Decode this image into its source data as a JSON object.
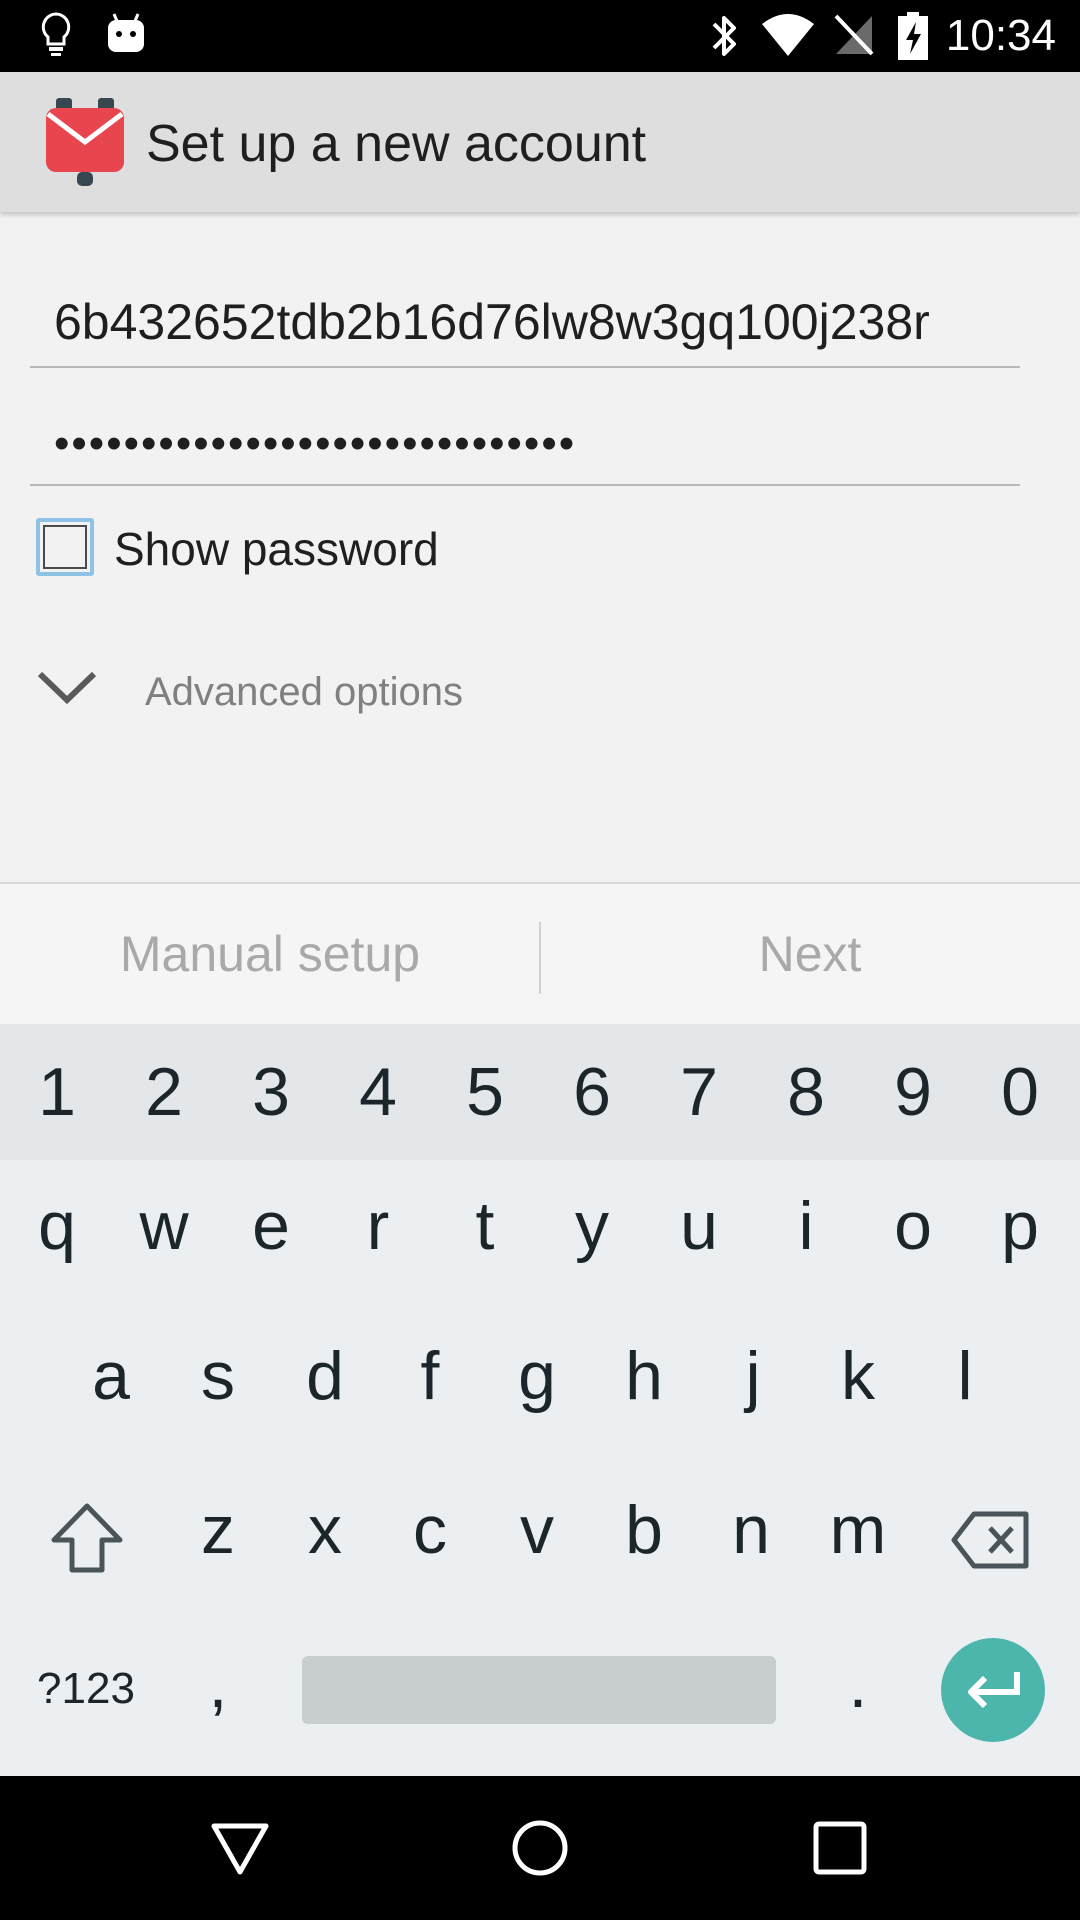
{
  "status_bar": {
    "time": "10:34",
    "icons": [
      "lightbulb-icon",
      "android-icon",
      "bluetooth-icon",
      "wifi-icon",
      "no-signal-icon",
      "battery-charging-icon"
    ]
  },
  "app_bar": {
    "title": "Set up a new account",
    "logo": "k9-mail-logo-icon"
  },
  "form": {
    "email_value": "6b432652tdb2b16d76lw8w3gq100j238r",
    "password_value": "••••••••••••••••••••••••••••••",
    "show_password_label": "Show password",
    "show_password_checked": false,
    "advanced_options_label": "Advanced options"
  },
  "buttons": {
    "manual_setup": "Manual setup",
    "next": "Next"
  },
  "keyboard": {
    "number_row": [
      "1",
      "2",
      "3",
      "4",
      "5",
      "6",
      "7",
      "8",
      "9",
      "0"
    ],
    "row1": [
      "q",
      "w",
      "e",
      "r",
      "t",
      "y",
      "u",
      "i",
      "o",
      "p"
    ],
    "row2": [
      "a",
      "s",
      "d",
      "f",
      "g",
      "h",
      "j",
      "k",
      "l"
    ],
    "row3": [
      "z",
      "x",
      "c",
      "v",
      "b",
      "n",
      "m"
    ],
    "symbols_label": "?123",
    "comma": ",",
    "period": ".",
    "accent_color": "#4db6ac"
  },
  "nav_bar": {
    "buttons": [
      "back-icon",
      "home-icon",
      "recents-icon"
    ]
  }
}
